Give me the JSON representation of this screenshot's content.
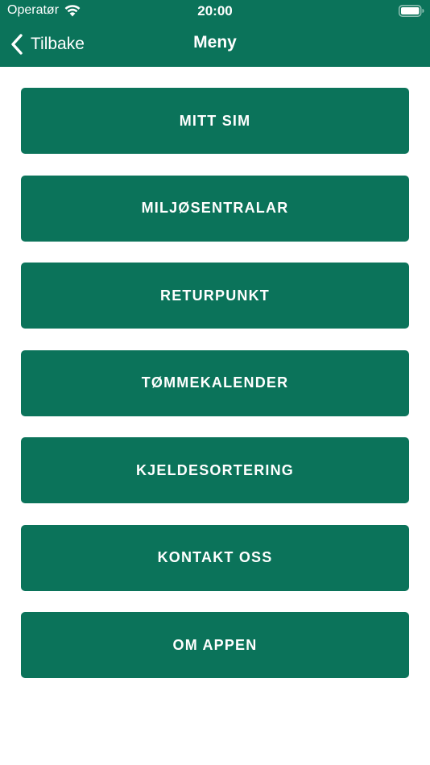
{
  "colors": {
    "brand": "#0b735a",
    "text_on_brand": "#ffffff",
    "background": "#ffffff"
  },
  "status_bar": {
    "carrier": "Operatør",
    "time": "20:00",
    "icons": [
      "wifi-icon",
      "battery-icon"
    ]
  },
  "nav": {
    "back_label": "Tilbake",
    "back_icon": "chevron-left-icon",
    "title": "Meny"
  },
  "menu": {
    "items": [
      {
        "label": "MITT SIM"
      },
      {
        "label": "MILJØSENTRALAR"
      },
      {
        "label": "RETURPUNKT"
      },
      {
        "label": "TØMMEKALENDER"
      },
      {
        "label": "KJELDESORTERING"
      },
      {
        "label": "KONTAKT OSS"
      },
      {
        "label": "OM APPEN"
      }
    ]
  }
}
